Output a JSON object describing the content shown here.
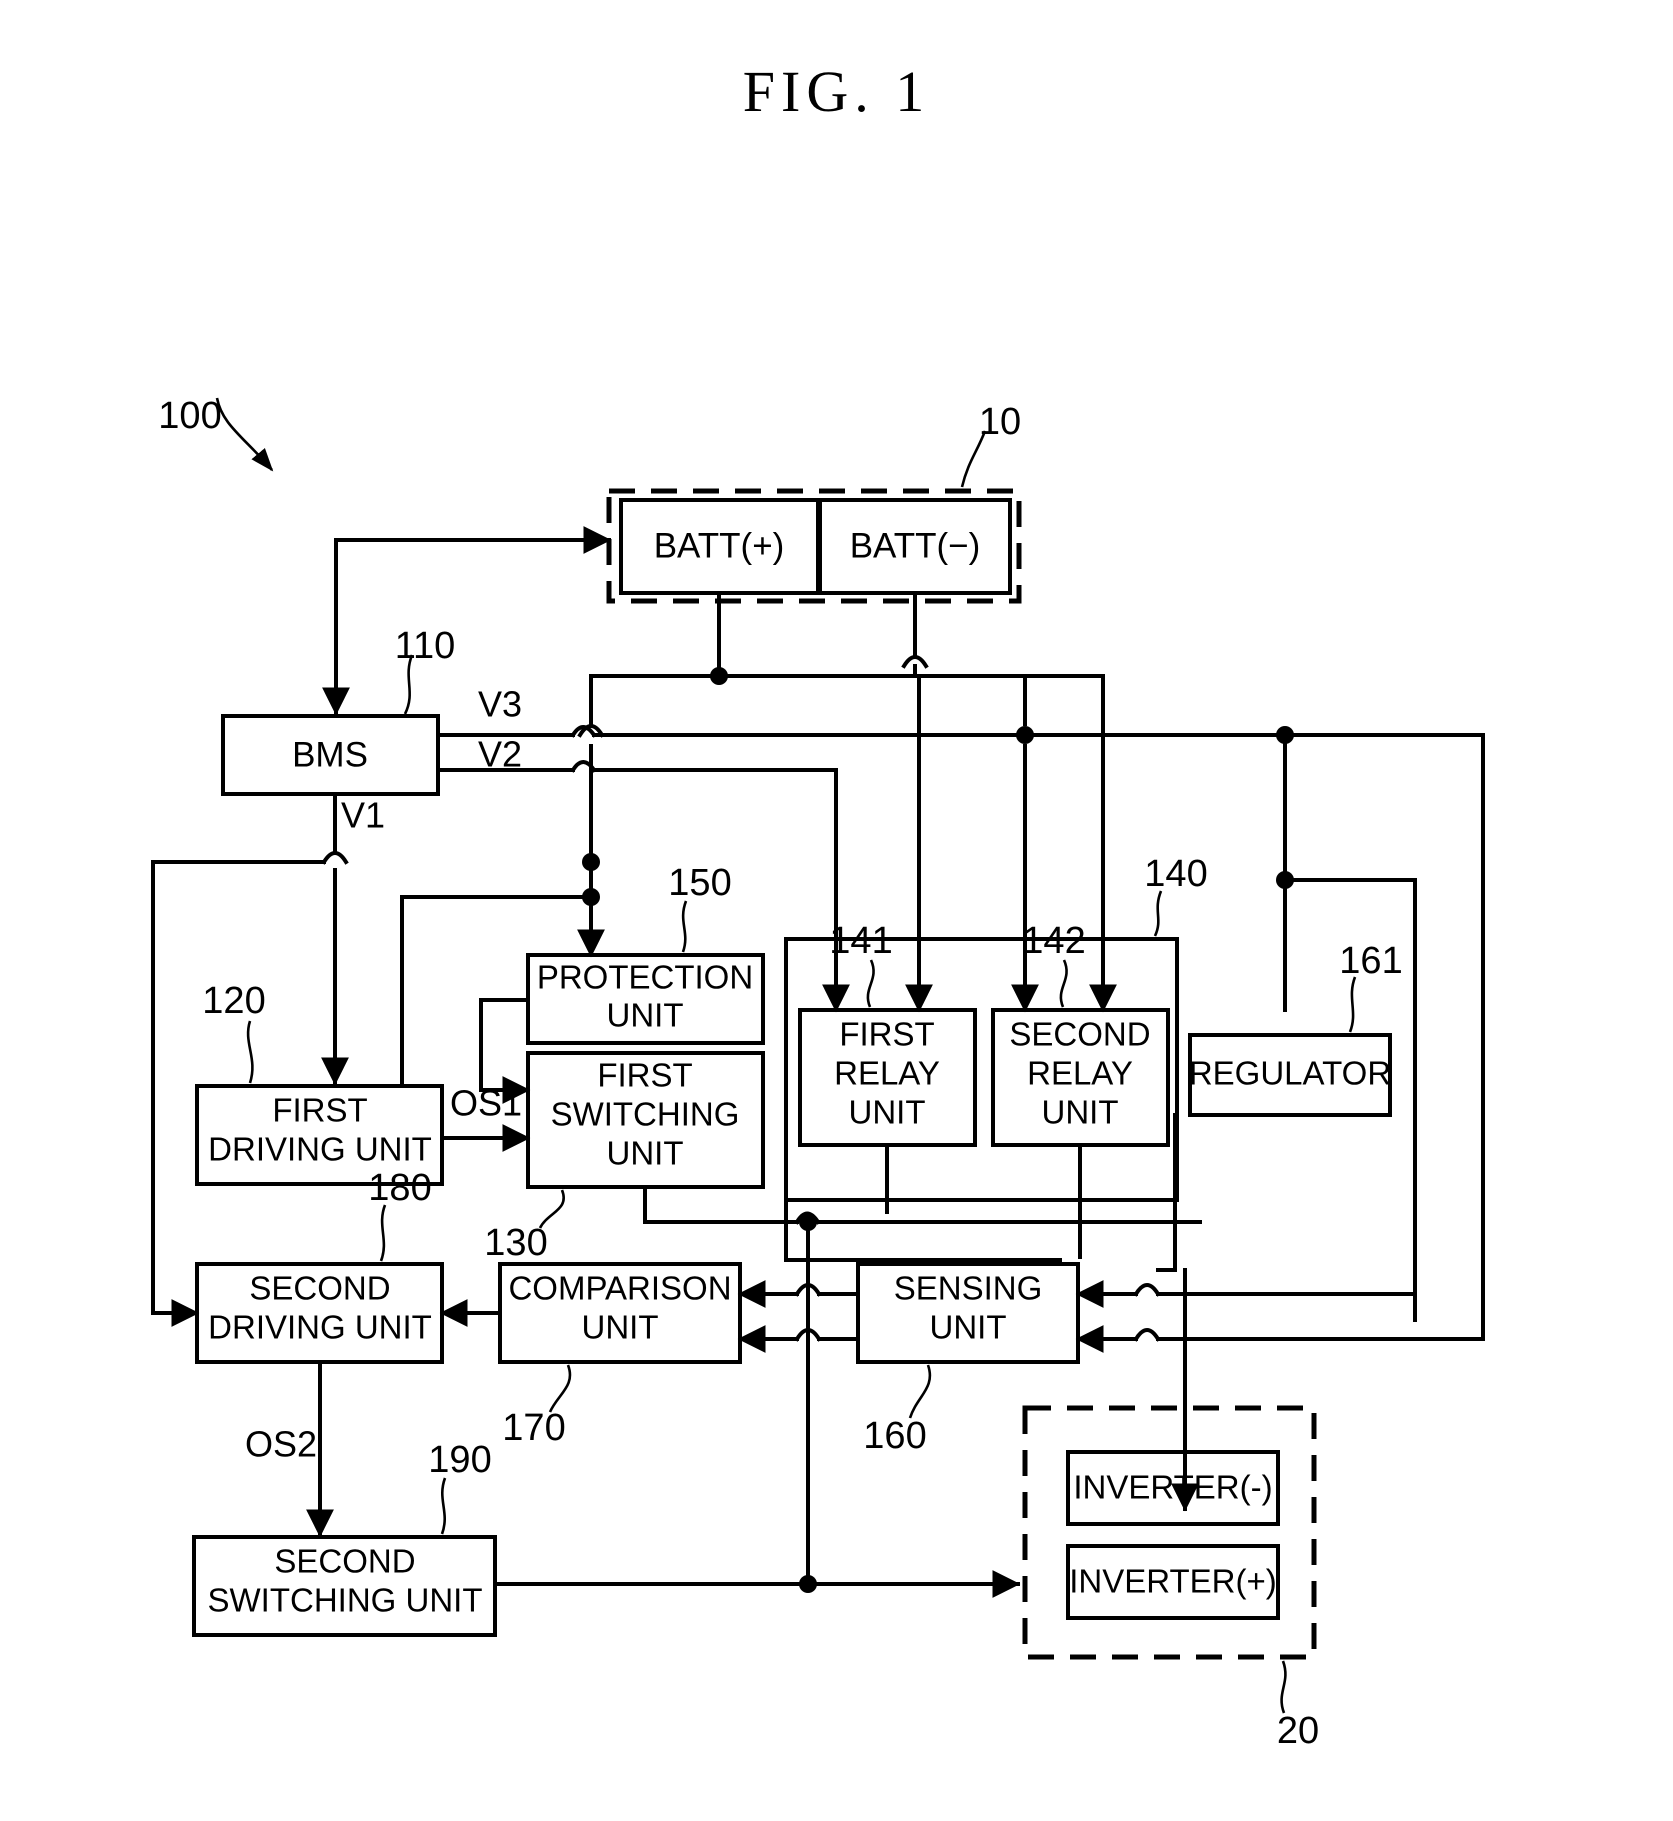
{
  "figure": {
    "title": "FIG. 1",
    "type": "patent-block-diagram"
  },
  "blocks": {
    "battery_pack": {
      "ref": "10",
      "children": [
        {
          "label": "BATT(+)"
        },
        {
          "label": "BATT(−)"
        }
      ]
    },
    "bms": {
      "ref": "110",
      "label": "BMS"
    },
    "protection_unit": {
      "ref": "150",
      "line1": "PROTECTION",
      "line2": "UNIT"
    },
    "first_switching_unit": {
      "ref": "130",
      "line1": "FIRST",
      "line2": "SWITCHING",
      "line3": "UNIT"
    },
    "first_driving_unit": {
      "ref": "120",
      "line1": "FIRST",
      "line2": "DRIVING UNIT"
    },
    "second_driving_unit": {
      "ref": "180",
      "line1": "SECOND",
      "line2": "DRIVING UNIT"
    },
    "second_switching_unit": {
      "ref": "190",
      "line1": "SECOND",
      "line2": "SWITCHING UNIT"
    },
    "comparison_unit": {
      "ref": "170",
      "line1": "COMPARISON",
      "line2": "UNIT"
    },
    "sensing_unit": {
      "ref": "160",
      "line1": "SENSING",
      "line2": "UNIT"
    },
    "relay_group": {
      "ref": "140",
      "first_relay": {
        "ref": "141",
        "line1": "FIRST",
        "line2": "RELAY",
        "line3": "UNIT"
      },
      "second_relay": {
        "ref": "142",
        "line1": "SECOND",
        "line2": "RELAY",
        "line3": "UNIT"
      }
    },
    "regulator": {
      "ref": "161",
      "label": "REGULATOR"
    },
    "inverter_group": {
      "ref": "20",
      "children": [
        {
          "label": "INVERTER(-)"
        },
        {
          "label": "INVERTER(+)"
        }
      ]
    },
    "system": {
      "ref": "100"
    }
  },
  "signals": {
    "v1": "V1",
    "v2": "V2",
    "v3": "V3",
    "os1": "OS1",
    "os2": "OS2"
  }
}
